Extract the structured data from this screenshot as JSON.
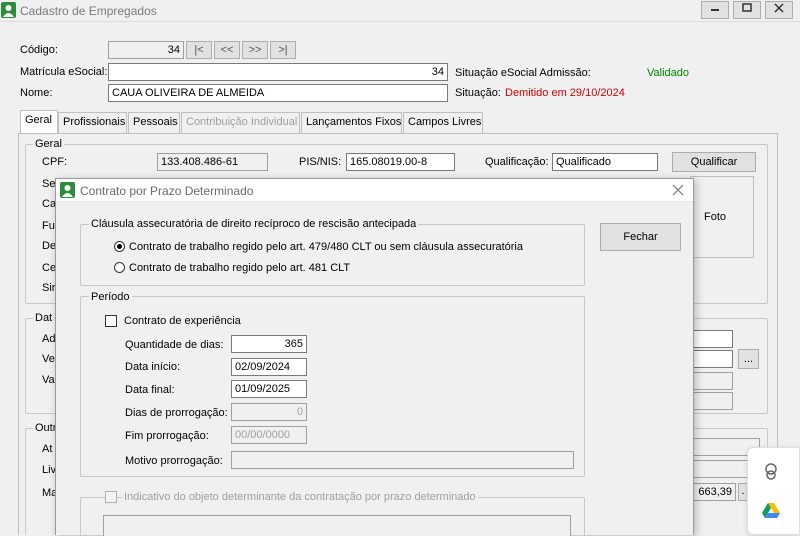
{
  "window": {
    "title": "Cadastro de Empregados"
  },
  "header": {
    "codigo_label": "Código:",
    "codigo_value": "34",
    "nav": [
      "|<",
      "<<",
      ">>",
      ">|"
    ],
    "matricula_label": "Matrícula eSocial:",
    "matricula_value": "34",
    "situacao_admissao_label": "Situação eSocial Admissão:",
    "situacao_admissao_value": "Validado",
    "nome_label": "Nome:",
    "nome_value": "CAUA OLIVEIRA DE ALMEIDA",
    "situacao_label": "Situação:",
    "situacao_value": "Demitido em 29/10/2024"
  },
  "tabs": [
    "Geral",
    "Profissionais",
    "Pessoais",
    "Contribuição Individual",
    "Lançamentos Fixos",
    "Campos Livres"
  ],
  "geral": {
    "group_label": "Geral",
    "cpf_label": "CPF:",
    "cpf_value": "133.408.486-61",
    "pis_label": "PIS/NIS:",
    "pis_value": "165.08019.00-8",
    "qualificacao_label": "Qualificação:",
    "qualificacao_value": "Qualificado",
    "qualificar_button": "Qualificar",
    "foto_label": "Foto",
    "partial_labels": [
      "Se",
      "Ca",
      "Fu",
      "De",
      "Ce",
      "Sir"
    ],
    "dat_label": "Dat",
    "dat_rows": [
      "Ad",
      "Ve",
      "Va"
    ],
    "outr_label": "Outr",
    "outr_rows": [
      "At",
      "Liv",
      "Ma"
    ],
    "ellipsis_button": "...",
    "valor_value": "663,39"
  },
  "dialog": {
    "title": "Contrato por Prazo Determinado",
    "clausula_group": "Cláusula assecuratória de direito recíproco de rescisão antecipada",
    "radio1": "Contrato de trabalho regido pelo art. 479/480 CLT ou sem cláusula assecuratória",
    "radio2": "Contrato de trabalho regido pelo art. 481 CLT",
    "fechar_button": "Fechar",
    "periodo_group": "Período",
    "experiencia_label": "Contrato de experiência",
    "quantidade_label": "Quantidade de dias:",
    "quantidade_value": "365",
    "inicio_label": "Data início:",
    "inicio_value": "02/09/2024",
    "final_label": "Data final:",
    "final_value": "01/09/2025",
    "prorrogacao_label": "Dias de prorrogação:",
    "prorrogacao_value": "0",
    "fim_prorrogacao_label": "Fim prorrogação:",
    "fim_prorrogacao_value": "00/00/0000",
    "motivo_label": "Motivo prorrogação:",
    "motivo_value": "",
    "indicativo_label": "Indicativo do objeto determinante da contratação por prazo determinado"
  },
  "colors": {
    "validado": "#008000",
    "demitido": "#d00000",
    "accent": "#2c8c3c"
  }
}
